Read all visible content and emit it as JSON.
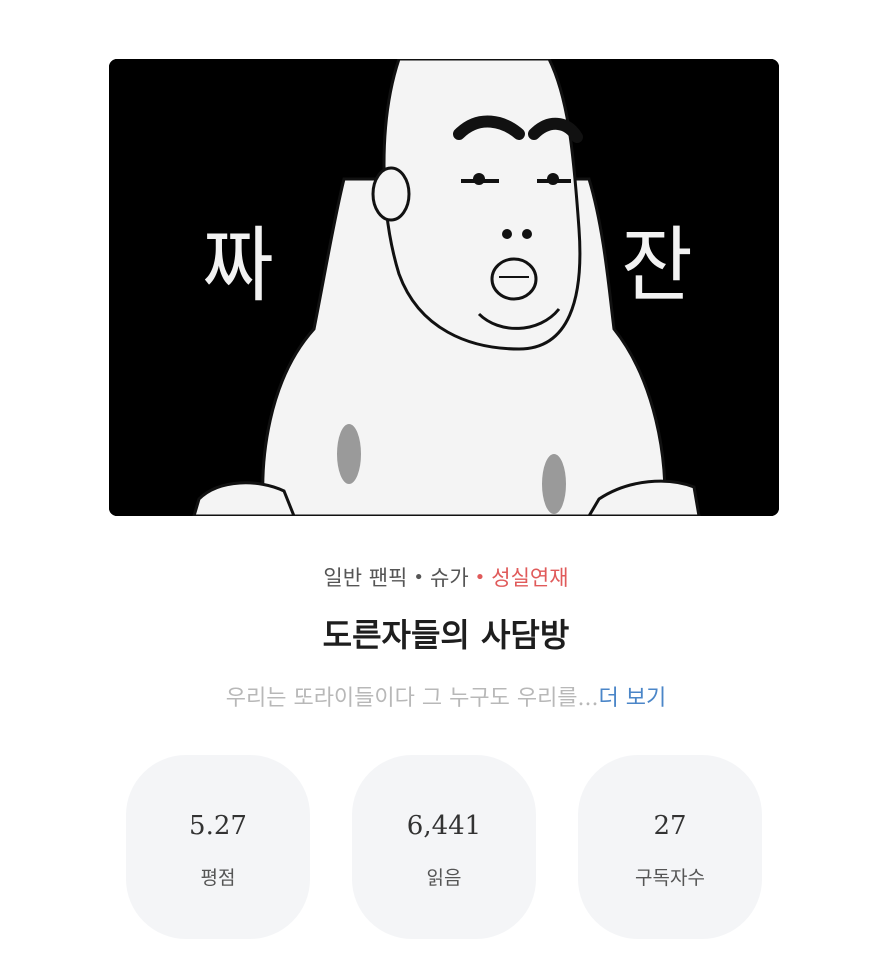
{
  "cover": {
    "left_text": "짜",
    "right_text": "잔"
  },
  "meta": {
    "genre": "일반 팬픽",
    "character": "슈가",
    "status": "성실연재",
    "dot": "•",
    "status_color": "#e05a5a"
  },
  "title": "도른자들의 사담방",
  "description": {
    "text": "우리는 또라이들이다 그 누구도 우리를...",
    "more_label": "더 보기",
    "more_color": "#4b86c8"
  },
  "stats": [
    {
      "value": "5.27",
      "label": "평점"
    },
    {
      "value": "6,441",
      "label": "읽음"
    },
    {
      "value": "27",
      "label": "구독자수"
    }
  ]
}
